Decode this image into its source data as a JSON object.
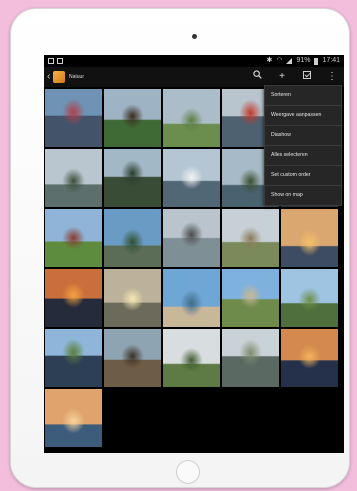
{
  "status_bar": {
    "battery": "91%",
    "time": "17:41"
  },
  "action_bar": {
    "title": "Natuur"
  },
  "overflow_menu": {
    "items": [
      "Sorteren",
      "Weergave aanpassen",
      "Diashow",
      "Alles selecteren",
      "Set custom order",
      "Show on map"
    ]
  },
  "grid": {
    "thumbs": [
      {
        "sky": "#6f93b5",
        "ground": "#42536a",
        "accent": "#b0404c"
      },
      {
        "sky": "#9eb4c4",
        "ground": "#3f6a35",
        "accent": "#3b2a1c"
      },
      {
        "sky": "#aabdc8",
        "ground": "#6b8d4d",
        "accent": "#5c7f44"
      },
      {
        "sky": "#b8c5cf",
        "ground": "#4d6171",
        "accent": "#c0392b"
      },
      {
        "sky": "#9fb6c6",
        "ground": "#3e5a3a",
        "accent": "#2f2f2f"
      },
      {
        "sky": "#b9c6cf",
        "ground": "#5d6f6c",
        "accent": "#3b4d3a"
      },
      {
        "sky": "#a2b8c6",
        "ground": "#394c36",
        "accent": "#2a3a2a"
      },
      {
        "sky": "#b4c6d3",
        "ground": "#516776",
        "accent": "#f4f4f4"
      },
      {
        "sky": "#a7bac7",
        "ground": "#48626f",
        "accent": "#3b4d2f"
      },
      {
        "sky": "#8ea7bb",
        "ground": "#3c5464",
        "accent": "#2b2b2b"
      },
      {
        "sky": "#8fb4d8",
        "ground": "#5d8c3f",
        "accent": "#8a3b2a"
      },
      {
        "sky": "#6a9bc4",
        "ground": "#5b6d57",
        "accent": "#2f4f2f"
      },
      {
        "sky": "#b9c4cc",
        "ground": "#7f8f96",
        "accent": "#4a4a4a"
      },
      {
        "sky": "#c6d0d6",
        "ground": "#7a8a5a",
        "accent": "#8c7a5b"
      },
      {
        "sky": "#d9a76f",
        "ground": "#3d4c62",
        "accent": "#f3c06b"
      },
      {
        "sky": "#c96f3c",
        "ground": "#262b3b",
        "accent": "#f2a240"
      },
      {
        "sky": "#bcb19a",
        "ground": "#6b6a5b",
        "accent": "#f5e7b4"
      },
      {
        "sky": "#6ea6d6",
        "ground": "#c9b79a",
        "accent": "#3f6d86"
      },
      {
        "sky": "#7fb1de",
        "ground": "#6f8b4c",
        "accent": "#c8b894"
      },
      {
        "sky": "#9ec4e2",
        "ground": "#4f6f3c",
        "accent": "#6d8f4a"
      },
      {
        "sky": "#8fb6da",
        "ground": "#2d3f55",
        "accent": "#5a7e3a"
      },
      {
        "sky": "#8fa4b3",
        "ground": "#6d5c46",
        "accent": "#3b3022"
      },
      {
        "sky": "#d8dde0",
        "ground": "#5f7b45",
        "accent": "#3f5a2f"
      },
      {
        "sky": "#c9d2d6",
        "ground": "#5a6a62",
        "accent": "#7c8c70"
      },
      {
        "sky": "#d48a4e",
        "ground": "#25314a",
        "accent": "#f2b25a"
      },
      {
        "sky": "#e0a36e",
        "ground": "#3d5c7c",
        "accent": "#f5d39a"
      }
    ]
  }
}
